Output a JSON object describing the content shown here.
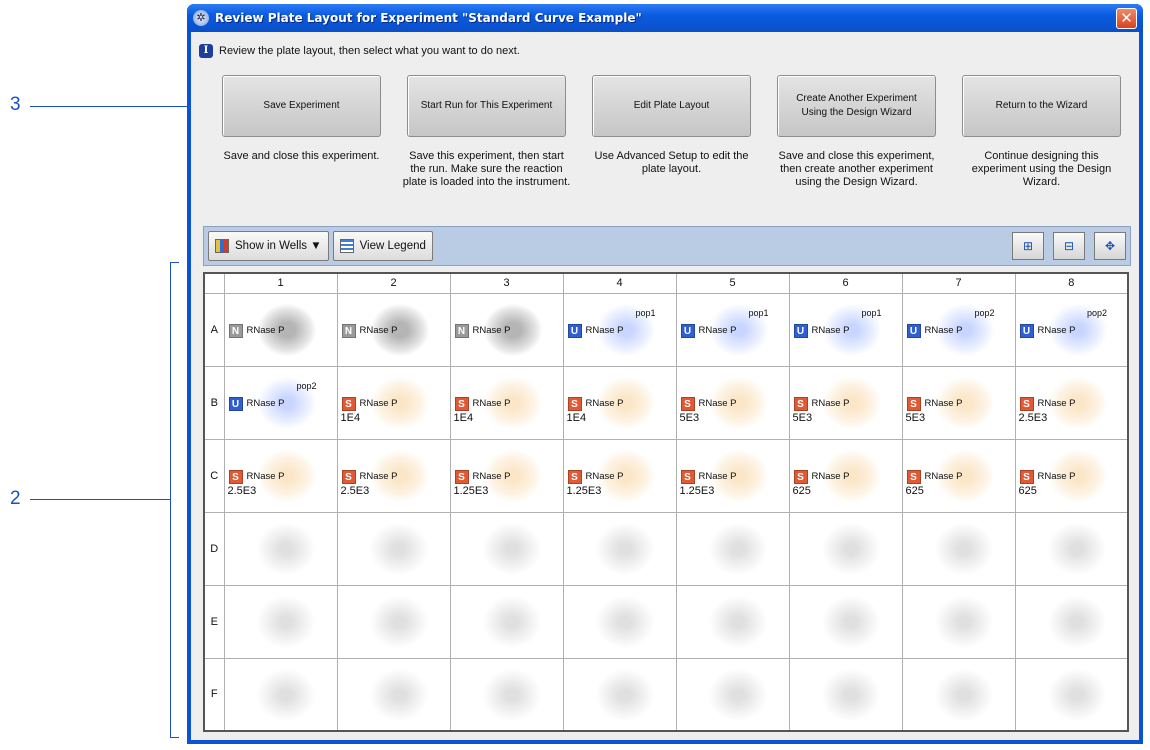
{
  "callouts": {
    "top": "3",
    "bottom": "2"
  },
  "window": {
    "title": "Review Plate Layout for Experiment \"Standard Curve Example\"",
    "close_glyph": "✕"
  },
  "info": {
    "icon": "I",
    "text": "Review the plate layout, then select what you want to do next."
  },
  "actions": [
    {
      "label": "Save Experiment",
      "desc": "Save and close this experiment."
    },
    {
      "label": "Start Run for This Experiment",
      "desc": "Save this experiment, then start the run. Make sure the reaction plate is loaded into the instrument."
    },
    {
      "label": "Edit Plate Layout",
      "desc": "Use Advanced Setup to edit the plate layout."
    },
    {
      "label": "Create Another Experiment Using the Design Wizard",
      "desc": "Save and close this experiment, then create another experiment using the Design Wizard."
    },
    {
      "label": "Return to the Wizard",
      "desc": "Continue designing this experiment using the Design Wizard."
    }
  ],
  "toolbar": {
    "show_in_wells": "Show in Wells ▼",
    "view_legend": "View Legend",
    "icons": [
      "zoom-in-icon",
      "zoom-out-icon",
      "fit-to-window-icon"
    ]
  },
  "plate": {
    "columns": [
      "1",
      "2",
      "3",
      "4",
      "5",
      "6",
      "7",
      "8"
    ],
    "rows": [
      "A",
      "B",
      "C",
      "D",
      "E",
      "F"
    ],
    "wells": [
      [
        {
          "task": "N",
          "target": "RNase P",
          "sample": "",
          "qty": ""
        },
        {
          "task": "N",
          "target": "RNase P",
          "sample": "",
          "qty": ""
        },
        {
          "task": "N",
          "target": "RNase P",
          "sample": "",
          "qty": ""
        },
        {
          "task": "U",
          "target": "RNase P",
          "sample": "pop1",
          "qty": ""
        },
        {
          "task": "U",
          "target": "RNase P",
          "sample": "pop1",
          "qty": ""
        },
        {
          "task": "U",
          "target": "RNase P",
          "sample": "pop1",
          "qty": ""
        },
        {
          "task": "U",
          "target": "RNase P",
          "sample": "pop2",
          "qty": ""
        },
        {
          "task": "U",
          "target": "RNase P",
          "sample": "pop2",
          "qty": ""
        }
      ],
      [
        {
          "task": "U",
          "target": "RNase P",
          "sample": "pop2",
          "qty": ""
        },
        {
          "task": "S",
          "target": "RNase P",
          "sample": "",
          "qty": "1E4"
        },
        {
          "task": "S",
          "target": "RNase P",
          "sample": "",
          "qty": "1E4"
        },
        {
          "task": "S",
          "target": "RNase P",
          "sample": "",
          "qty": "1E4"
        },
        {
          "task": "S",
          "target": "RNase P",
          "sample": "",
          "qty": "5E3"
        },
        {
          "task": "S",
          "target": "RNase P",
          "sample": "",
          "qty": "5E3"
        },
        {
          "task": "S",
          "target": "RNase P",
          "sample": "",
          "qty": "5E3"
        },
        {
          "task": "S",
          "target": "RNase P",
          "sample": "",
          "qty": "2.5E3"
        }
      ],
      [
        {
          "task": "S",
          "target": "RNase P",
          "sample": "",
          "qty": "2.5E3"
        },
        {
          "task": "S",
          "target": "RNase P",
          "sample": "",
          "qty": "2.5E3"
        },
        {
          "task": "S",
          "target": "RNase P",
          "sample": "",
          "qty": "1.25E3"
        },
        {
          "task": "S",
          "target": "RNase P",
          "sample": "",
          "qty": "1.25E3"
        },
        {
          "task": "S",
          "target": "RNase P",
          "sample": "",
          "qty": "1.25E3"
        },
        {
          "task": "S",
          "target": "RNase P",
          "sample": "",
          "qty": "625"
        },
        {
          "task": "S",
          "target": "RNase P",
          "sample": "",
          "qty": "625"
        },
        {
          "task": "S",
          "target": "RNase P",
          "sample": "",
          "qty": "625"
        }
      ]
    ],
    "empty_rows": 3,
    "colors": {
      "N": "#9a9a9a",
      "U": "#2f5fd0",
      "S": "#e05a36"
    }
  }
}
